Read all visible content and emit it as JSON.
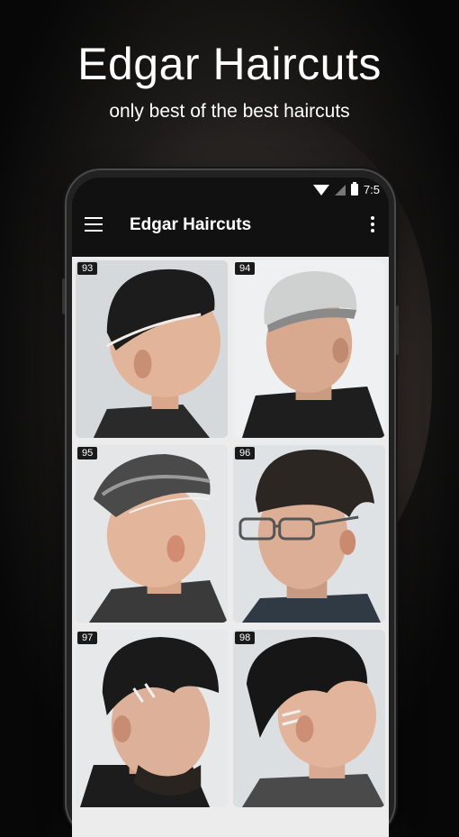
{
  "hero": {
    "title": "Edgar Haircuts",
    "subtitle": "only best of the best haircuts"
  },
  "status_bar": {
    "time": "7:5"
  },
  "app_bar": {
    "title": "Edgar Haircuts",
    "menu_icon": "hamburger-menu-icon",
    "overflow_icon": "more-vert-icon"
  },
  "cards": [
    {
      "number": "93"
    },
    {
      "number": "94"
    },
    {
      "number": "95"
    },
    {
      "number": "96"
    },
    {
      "number": "97"
    },
    {
      "number": "98"
    }
  ],
  "colors": {
    "app_bar": "#111111",
    "grid_background": "#ececec"
  }
}
